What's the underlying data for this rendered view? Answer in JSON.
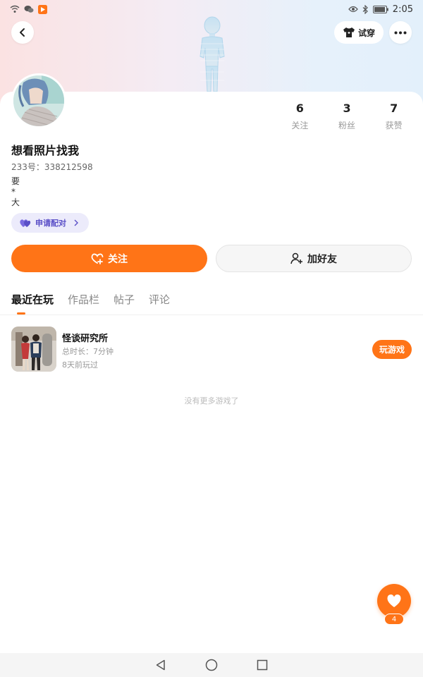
{
  "status_bar": {
    "time": "2:05",
    "left_icons": [
      "wifi-icon",
      "wechat-icon",
      "app-notification-icon"
    ],
    "right_icons": [
      "eye-icon",
      "bluetooth-icon",
      "battery-icon"
    ]
  },
  "header": {
    "back_icon": "back-arrow-icon",
    "tryon_label": "试穿",
    "more_icon": "more-dots-icon"
  },
  "profile": {
    "name": "想看照片找我",
    "uid": "233号：338212598",
    "bio_lines": [
      "要",
      "*",
      "大"
    ],
    "match_label": "申请配对",
    "stats": [
      {
        "value": "6",
        "label": "关注"
      },
      {
        "value": "3",
        "label": "粉丝"
      },
      {
        "value": "7",
        "label": "获赞"
      }
    ]
  },
  "actions": {
    "follow_label": "关注",
    "add_friend_label": "加好友"
  },
  "tabs": [
    {
      "label": "最近在玩",
      "active": true
    },
    {
      "label": "作品栏",
      "active": false
    },
    {
      "label": "帖子",
      "active": false
    },
    {
      "label": "评论",
      "active": false
    }
  ],
  "games": [
    {
      "title": "怪谈研究所",
      "duration": "总时长：7分钟",
      "last_played": "8天前玩过",
      "play_label": "玩游戏"
    }
  ],
  "empty_hint": "没有更多游戏了",
  "fab": {
    "count": "4"
  },
  "colors": {
    "accent": "#ff7417",
    "match_chip": "#ecebfb",
    "match_text": "#5a4fc7"
  }
}
